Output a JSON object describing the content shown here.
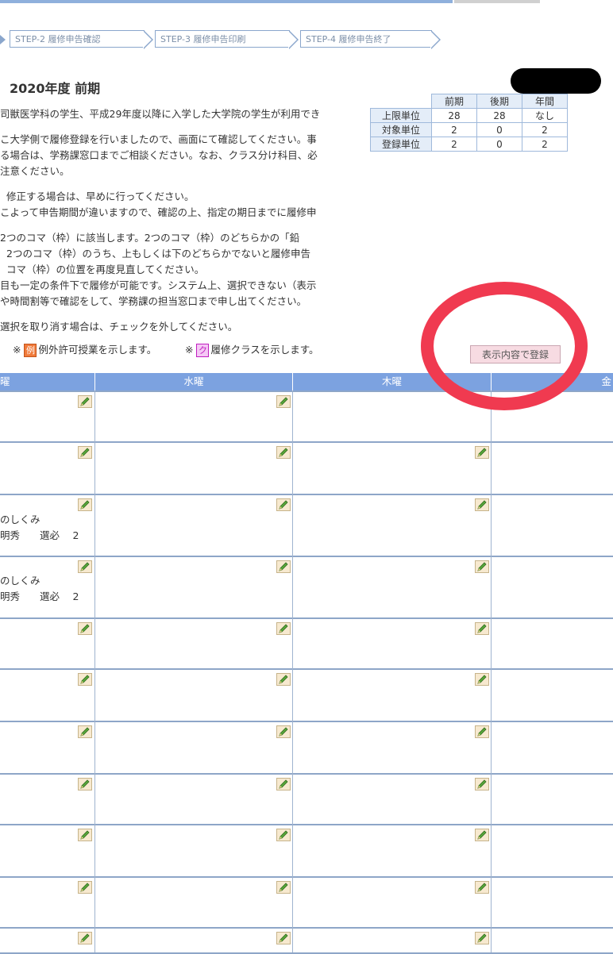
{
  "steps": [
    {
      "label": "STEP-2  履修申告確認"
    },
    {
      "label": "STEP-3  履修申告印刷"
    },
    {
      "label": "STEP-4  履修申告終了"
    }
  ],
  "page_title": "2020年度 前期",
  "units_table": {
    "headers": [
      "前期",
      "後期",
      "年間"
    ],
    "rows": [
      {
        "label": "上限単位",
        "values": [
          "28",
          "28",
          "なし"
        ]
      },
      {
        "label": "対象単位",
        "values": [
          "2",
          "0",
          "2"
        ]
      },
      {
        "label": "登録単位",
        "values": [
          "2",
          "0",
          "2"
        ]
      }
    ]
  },
  "notes": [
    "司獣医学科の学生、平成29年度以降に入学した大学院の学生が利用でき",
    "",
    "こ大学側で履修登録を行いましたので、画面にて確認してください。事",
    "る場合は、学務課窓口までご相談ください。なお、クラス分け科目、必",
    "注意ください。",
    "",
    "修正する場合は、早めに行ってください。",
    "こよって申告期間が違いますので、確認の上、指定の期日までに履修申",
    "",
    "2つのコマ（枠）に該当します。2つのコマ（枠）のどちらかの「鉛",
    "2つのコマ（枠）のうち、上もしくは下のどちらかでないと履修申告",
    "コマ（枠）の位置を再度見直してください。",
    "目も一定の条件下で履修が可能です。システム上、選択できない（表示",
    "や時間割等で確認をして、学務課の担当窓口まで申し出てください。",
    "",
    "選択を取り消す場合は、チェックを外してください。"
  ],
  "legend": {
    "exception": {
      "prefix": "※",
      "badge": "例",
      "text": "例外許可授業を示します。"
    },
    "class": {
      "prefix": "※",
      "badge": "ク",
      "text": "履修クラスを示します。"
    }
  },
  "register_button": "表示内容で登録",
  "timetable": {
    "headers": [
      "曜",
      "水曜",
      "木曜",
      "金"
    ],
    "courses": [
      {
        "name": "のしくみ",
        "detail": "明秀　　選必　 2"
      },
      {
        "name": "のしくみ",
        "detail": "明秀　　選必　 2"
      }
    ]
  },
  "colors": {
    "header_blue": "#7ca2e0",
    "annotation_red": "#f03a50",
    "register_button_bg": "#f7dbe2",
    "badge_exception": "#f07a3a",
    "badge_class": "#c020c0"
  },
  "icons": [
    "pencil-icon"
  ]
}
